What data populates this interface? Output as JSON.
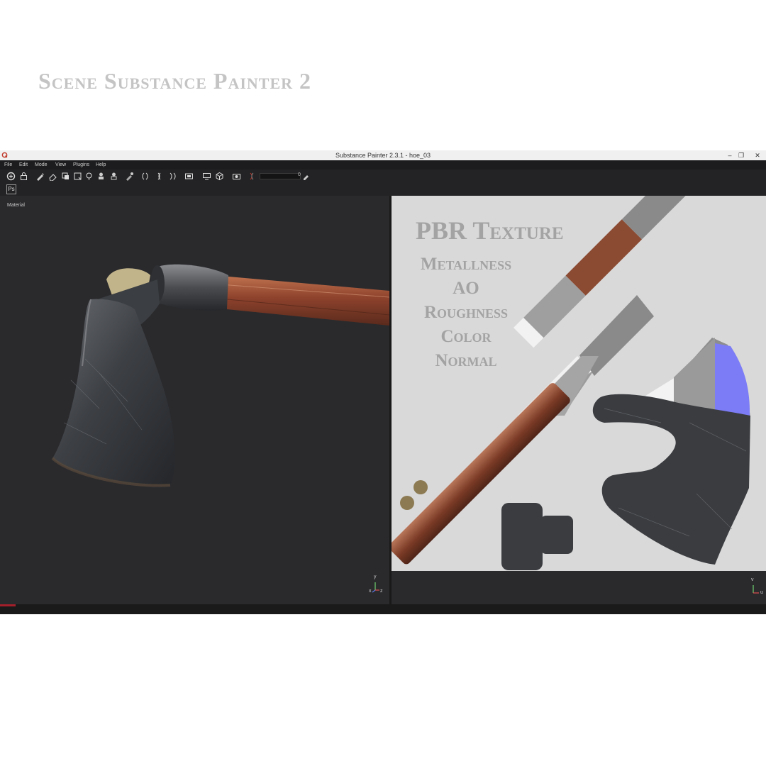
{
  "caption": "Scene Substance Painter 2",
  "window": {
    "title": "Substance Painter 2.3.1 - hoe_03",
    "minimize": "–",
    "maximize": "❐",
    "close": "✕"
  },
  "menu": [
    "File",
    "Edit",
    "Mode",
    "View",
    "Plugins",
    "Help"
  ],
  "toolbar": {
    "slider_value": "0",
    "plugin_button": "Ps"
  },
  "viewport3d": {
    "label": "Material",
    "axis": {
      "x": "x",
      "y": "y",
      "z": "z"
    }
  },
  "viewport2d": {
    "heading": "PBR Texture",
    "channels": [
      "Metallness",
      "AO",
      "Roughness",
      "Color",
      "Normal"
    ],
    "axis": {
      "v": "v",
      "u": "u"
    }
  },
  "status": {
    "progress": 0.02
  },
  "colors": {
    "accent": "#a3202a",
    "normal_map": "#7c7cf6",
    "wood": "#8b4a32",
    "metal": "#3a3c40"
  }
}
